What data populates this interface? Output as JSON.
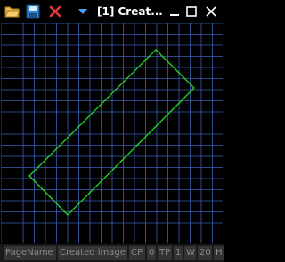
{
  "window": {
    "title": "[1] Creat...",
    "icons": [
      "folder-open-icon",
      "save-icon",
      "close-red-icon",
      "dropdown-arrow-icon"
    ],
    "controls": [
      "minimize-icon",
      "maximize-icon",
      "close-icon"
    ]
  },
  "colors": {
    "grid": "#3a5fb5",
    "shape": "#22dd22",
    "background": "#000000",
    "status_text": "#8a8a8a"
  },
  "status": {
    "page_name": "PageName",
    "image_status": "Created image",
    "cp_label": "CP",
    "cp_value": "0",
    "tp_label": "TP",
    "tp_value": "1",
    "w_label": "W",
    "w_value": "20",
    "h_label": "H"
  }
}
